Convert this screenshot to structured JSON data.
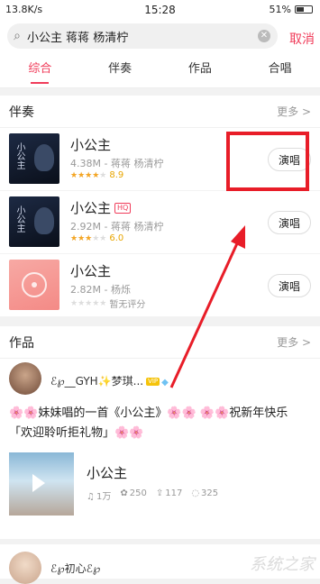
{
  "status_bar": {
    "left": "13.8K/s",
    "time": "15:28",
    "battery": "51%"
  },
  "search": {
    "query": "小公主 蒋蒋 杨清柠",
    "cancel_label": "取消"
  },
  "tabs": [
    {
      "label": "综合",
      "active": true
    },
    {
      "label": "伴奏",
      "active": false
    },
    {
      "label": "作品",
      "active": false
    },
    {
      "label": "合唱",
      "active": false
    }
  ],
  "accompaniment": {
    "title": "伴奏",
    "more_label": "更多 >",
    "items": [
      {
        "name": "小公主",
        "meta": "4.38M - 蒋蒋 杨清柠",
        "stars": 4,
        "rating": "8.9",
        "hq": "",
        "sing_label": "演唱"
      },
      {
        "name": "小公主",
        "meta": "2.92M - 蒋蒋 杨清柠",
        "stars": 3,
        "rating": "6.0",
        "hq": "HQ",
        "sing_label": "演唱"
      },
      {
        "name": "小公主",
        "meta": "2.82M - 杨烁",
        "stars": 0,
        "rating": "暂无评分",
        "hq": "",
        "sing_label": "演唱"
      }
    ]
  },
  "works": {
    "title": "作品",
    "more_label": "更多 >",
    "user": {
      "name": "ℰ℘__GYH✨梦琪...",
      "vip": "VIP"
    },
    "description": "🌸🌸妹妹唱的一首《小公主》🌸🌸 🌸🌸祝新年快乐「欢迎聆听拒礼物」🌸🌸",
    "card": {
      "title": "小公主",
      "plays": "1万",
      "likes": "250",
      "shares": "117",
      "comments": "325"
    }
  },
  "next_user": {
    "name": "ℰ℘初心ℰ℘"
  },
  "accent_color": "#f03c5a"
}
